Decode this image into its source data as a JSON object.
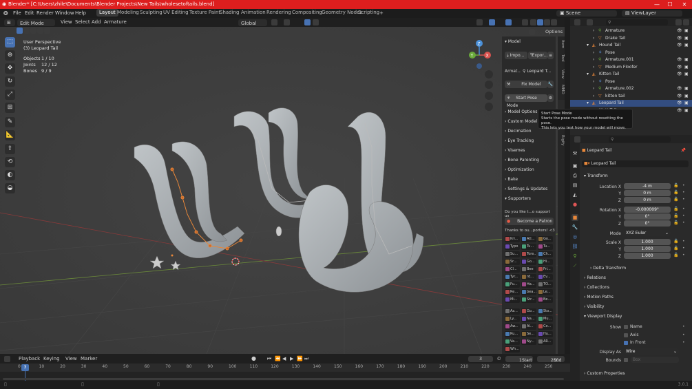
{
  "window": {
    "title": "Blender* [C:\\Users\\zhile\\Documents\\Blender Projects\\New Tails\\wholesetoftails.blend]",
    "minimize": "—",
    "maximize": "☐",
    "close": "✕"
  },
  "menubar": {
    "items": [
      "File",
      "Edit",
      "Render",
      "Window",
      "Help"
    ],
    "workspaces": [
      "Layout",
      "Modeling",
      "Sculpting",
      "UV Editing",
      "Texture Paint",
      "Shading",
      "Animation",
      "Rendering",
      "Compositing",
      "Geometry Nodes",
      "Scripting"
    ],
    "active_workspace": "Layout",
    "add_tab": "+",
    "scene": "Scene",
    "view_layer": "ViewLayer"
  },
  "viewport_header": {
    "mode": "Edit Mode",
    "menus": [
      "View",
      "Select",
      "Add",
      "Armature"
    ],
    "transform_orientation": "Global",
    "options": "Options"
  },
  "viewport": {
    "view_name": "User Perspective",
    "object_name": "(3) Leopard Tail",
    "stats": [
      {
        "label": "Objects",
        "value": "1 / 10"
      },
      {
        "label": "Joints",
        "value": "12 / 12"
      },
      {
        "label": "Bones",
        "value": "9 / 9"
      }
    ],
    "gizmo": {
      "x": "X",
      "y": "Y",
      "z": "Z"
    }
  },
  "tools": [
    "select-box",
    "cursor",
    "move",
    "rotate",
    "scale",
    "transform",
    "annotate",
    "measure",
    "extrude",
    "roll",
    "bone-size",
    "envelope"
  ],
  "n_panel": {
    "tabs": [
      "Item",
      "Tool",
      "View",
      "MMD",
      "Rigify"
    ],
    "model_header": "Model",
    "import_btn": "Impo...",
    "export_btn": "Expor...",
    "armature_label": "Armat...",
    "armature_value": "Leopard T...",
    "fix_model": "Fix Model",
    "start_pose": "Start Pose Mode",
    "sections": [
      "Model Options",
      "Custom Model C",
      "Decimation",
      "Eye Tracking",
      "Visemes",
      "Bone Parenting",
      "Optimization",
      "Bake",
      "Settings & Updates",
      "Supporters"
    ],
    "support_text": "Do you like t...o support us",
    "patron_btn": "Become a Patron",
    "thanks_text": "Thanks to ou...porters! <3",
    "supporters": [
      "Kri...",
      "Atl...",
      "Go...",
      "Typo",
      "Tu...",
      "Tu...",
      "Su...",
      "Tore...",
      "Ch...",
      "Sr...",
      "Go...",
      "Hi...",
      "Cl...",
      "Bee",
      "Fri...",
      "Tyr...",
      "rd...",
      "Ev...",
      "Fu...",
      "Ha...",
      "TO...",
      "Re...",
      "bea...",
      "Le...",
      "Mi...",
      "Str...",
      "Be...",
      "Az...",
      "Go...",
      "Sto...",
      "Ly...",
      "Na...",
      "Mu...",
      "Aw...",
      "Al...",
      "Co...",
      "Ru...",
      "Se...",
      "Hu...",
      "Va...",
      "Ny...",
      "AR...",
      "Wh..."
    ]
  },
  "tooltip": {
    "title": "Start Pose Mode",
    "body1": "Starts the pose mode without resetting the pose.",
    "body2": "This lets you test how your model will move."
  },
  "outliner": {
    "rows": [
      {
        "label": "Armature",
        "indent": 3,
        "kind": "armature"
      },
      {
        "label": "Drake Tail",
        "indent": 3,
        "kind": "mesh"
      },
      {
        "label": "Hound Tail",
        "indent": 2,
        "kind": "object"
      },
      {
        "label": "Pose",
        "indent": 3,
        "kind": "pose"
      },
      {
        "label": "Armature.001",
        "indent": 3,
        "kind": "armature"
      },
      {
        "label": "Medium Floofer",
        "indent": 3,
        "kind": "mesh"
      },
      {
        "label": "Kitten Tail",
        "indent": 2,
        "kind": "object"
      },
      {
        "label": "Pose",
        "indent": 3,
        "kind": "pose"
      },
      {
        "label": "Armature.002",
        "indent": 3,
        "kind": "armature"
      },
      {
        "label": "kitten tail",
        "indent": 3,
        "kind": "mesh"
      },
      {
        "label": "Leopard Tail",
        "indent": 2,
        "kind": "object",
        "selected": true
      },
      {
        "label": "Mutt Tail",
        "indent": 2,
        "kind": "object"
      }
    ]
  },
  "properties": {
    "object_name": "Leopard Tail",
    "data_name": "Leopard Tail",
    "transform_header": "Transform",
    "location_label": "Location X",
    "location": [
      "-4 m",
      "0 m",
      "0 m"
    ],
    "rotation_label": "Rotation X",
    "rotation": [
      "-0.000009°",
      "0°",
      "0°"
    ],
    "mode_label": "Mode",
    "mode_value": "XYZ Euler",
    "scale_label": "Scale X",
    "scale": [
      "1.000",
      "1.000",
      "1.000"
    ],
    "axis_y": "Y",
    "axis_z": "Z",
    "sections": [
      "Delta Transform",
      "Relations",
      "Collections",
      "Motion Paths",
      "Visibility"
    ],
    "viewport_display": "Viewport Display",
    "show_label": "Show",
    "show_options": [
      {
        "label": "Name",
        "checked": false
      },
      {
        "label": "Axis",
        "checked": false
      },
      {
        "label": "In Front",
        "checked": true
      }
    ],
    "display_as_label": "Display As",
    "display_as_value": "Wire",
    "bounds_label": "Bounds",
    "bounds_value": "Box",
    "custom_props": "Custom Properties"
  },
  "timeline": {
    "menus": [
      "Playback",
      "Keying",
      "View",
      "Marker"
    ],
    "current_frame": "3",
    "start_label": "Start",
    "start": "1",
    "end_label": "End",
    "end": "250",
    "ticks": [
      "0",
      "10",
      "20",
      "30",
      "40",
      "50",
      "60",
      "70",
      "80",
      "90",
      "100",
      "110",
      "120",
      "130",
      "140",
      "150",
      "160",
      "170",
      "180",
      "190",
      "200",
      "210",
      "220",
      "230",
      "240",
      "250"
    ],
    "playhead": "3"
  },
  "status": {
    "version": "3.0.1"
  }
}
